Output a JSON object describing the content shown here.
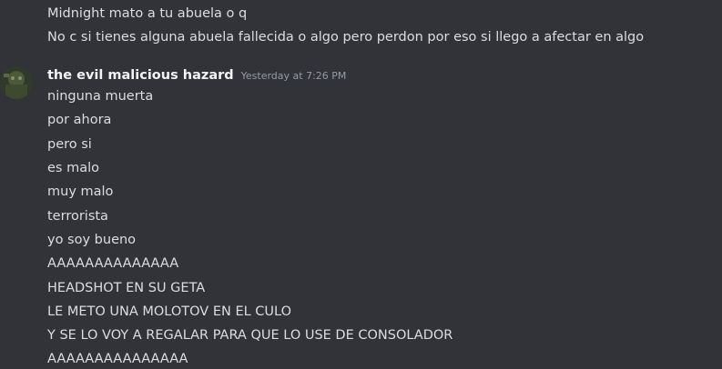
{
  "prev_messages": [
    "Midnight mato a tu abuela o q",
    "No c si tienes alguna abuela fallecida o algo pero perdon por eso si llego a afectar en algo"
  ],
  "group": {
    "username": "the evil malicious hazard",
    "timestamp": "Yesterday at 7:26 PM",
    "messages": [
      "ninguna muerta",
      "por ahora",
      "pero si",
      "es malo",
      "muy malo",
      "terrorista",
      "yo soy bueno",
      "AAAAAAAAAAAAAA",
      "HEADSHOT EN SU GETA",
      "LE METO UNA MOLOTOV EN EL CULO",
      "Y SE LO VOY A REGALAR PARA QUE LO USE DE CONSOLADOR",
      "AAAAAAAAAAAAAAA"
    ]
  }
}
